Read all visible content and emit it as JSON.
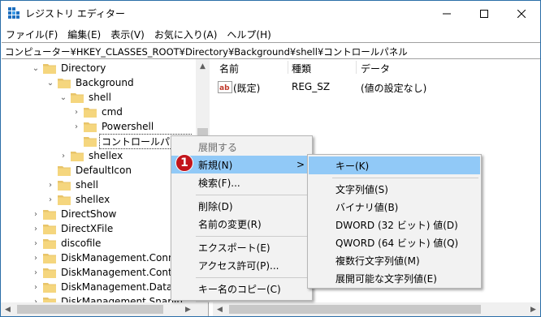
{
  "window": {
    "title": "レジストリ エディター",
    "address": "コンピューター¥HKEY_CLASSES_ROOT¥Directory¥Background¥shell¥コントロールパネル"
  },
  "menu": [
    "ファイル(F)",
    "編集(E)",
    "表示(V)",
    "お気に入り(A)",
    "ヘルプ(H)"
  ],
  "tree": [
    {
      "label": "Directory",
      "chev": "v"
    },
    {
      "label": "Background",
      "chev": "v"
    },
    {
      "label": "shell",
      "chev": "v"
    },
    {
      "label": "cmd",
      "chev": ">"
    },
    {
      "label": "Powershell",
      "chev": ">"
    },
    {
      "label": "コントロールパネル",
      "chev": ""
    },
    {
      "label": "shellex",
      "chev": ">"
    },
    {
      "label": "DefaultIcon",
      "chev": ""
    },
    {
      "label": "shell",
      "chev": ">"
    },
    {
      "label": "shellex",
      "chev": ">"
    },
    {
      "label": "DirectShow",
      "chev": ">"
    },
    {
      "label": "DirectXFile",
      "chev": ">"
    },
    {
      "label": "discofile",
      "chev": ">"
    },
    {
      "label": "DiskManagement.Connec",
      "chev": ">"
    },
    {
      "label": "DiskManagement.Control",
      "chev": ">"
    },
    {
      "label": "DiskManagement.DataOb",
      "chev": ">"
    },
    {
      "label": "DiskManagement.SnapIn",
      "chev": ">"
    }
  ],
  "list": {
    "headers": {
      "name": "名前",
      "type": "種類",
      "data": "データ"
    },
    "rows": [
      {
        "name": "(既定)",
        "type": "REG_SZ",
        "data": "(値の設定なし)"
      }
    ]
  },
  "context_menu": {
    "expand": "展開する",
    "new": "新規(N)",
    "new_arrow": ">",
    "find": "検索(F)...",
    "delete": "削除(D)",
    "rename": "名前の変更(R)",
    "export": "エクスポート(E)",
    "permissions": "アクセス許可(P)...",
    "copy_key_name": "キー名のコピー(C)"
  },
  "submenu": {
    "key": "キー(K)",
    "string": "文字列値(S)",
    "binary": "バイナリ値(B)",
    "dword": "DWORD (32 ビット) 値(D)",
    "qword": "QWORD (64 ビット) 値(Q)",
    "multi_string": "複数行文字列値(M)",
    "expandable_string": "展開可能な文字列値(E)"
  },
  "badge": "1",
  "colors": {
    "highlight": "#91c9f7",
    "folder": "#e8c46a",
    "badge": "#c2151c",
    "menu_bg": "#f2f2f2"
  }
}
